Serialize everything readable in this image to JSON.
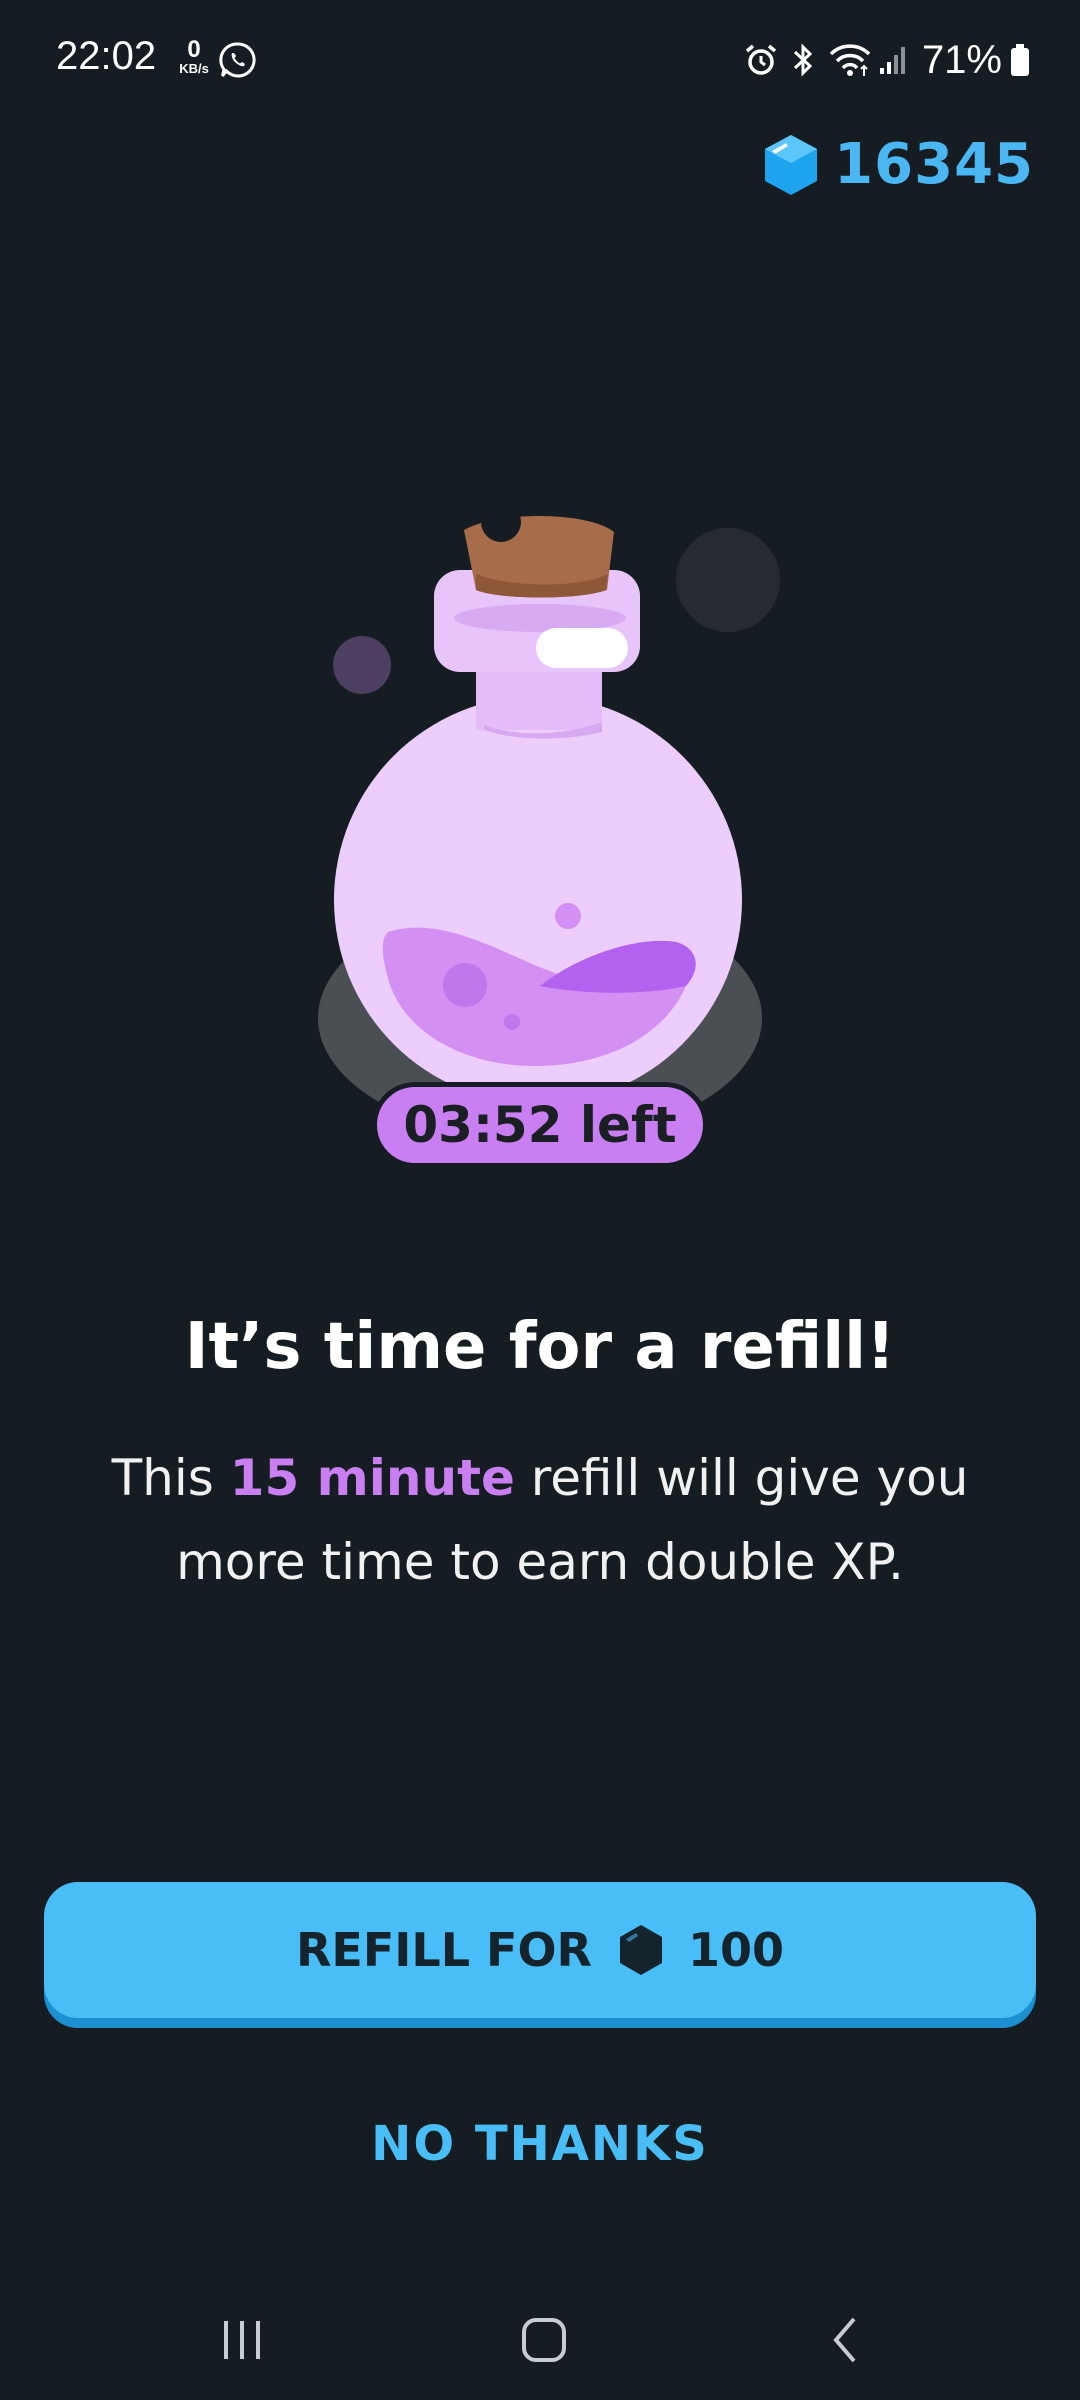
{
  "status_bar": {
    "time": "22:02",
    "net_speed_value": "0",
    "net_speed_unit": "KB/s",
    "battery_percent": "71%",
    "icons": [
      "whatsapp-icon",
      "alarm-icon",
      "bluetooth-icon",
      "wifi-icon",
      "signal-icon",
      "battery-icon"
    ]
  },
  "gems": {
    "count": "16345",
    "icon": "gem-icon"
  },
  "potion": {
    "timer_label": "03:52 left"
  },
  "content": {
    "title": "It’s time for a refill!",
    "desc_before": "This ",
    "desc_highlight": "15 minute",
    "desc_after": " refill will give you more time to earn double XP."
  },
  "actions": {
    "refill_label": "REFILL FOR",
    "refill_cost": "100",
    "no_thanks_label": "NO THANKS"
  },
  "nav": {
    "icons": [
      "recents-icon",
      "home-icon",
      "back-icon"
    ]
  },
  "colors": {
    "background": "#151d22",
    "accent_blue": "#49bdf5",
    "accent_purple": "#c97ef2"
  }
}
